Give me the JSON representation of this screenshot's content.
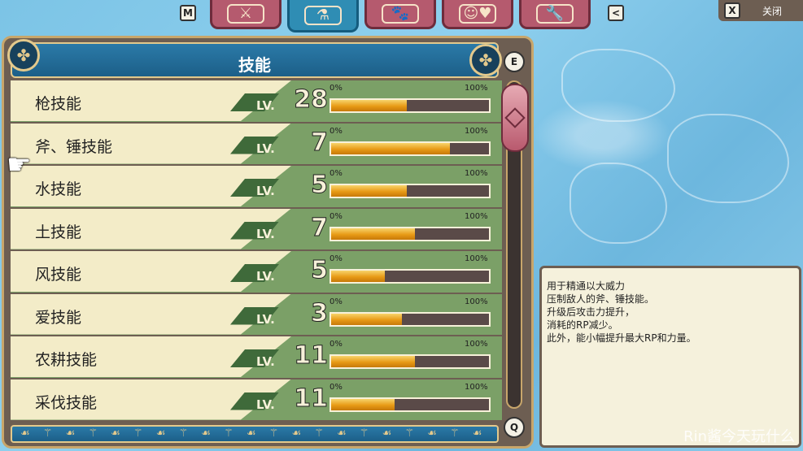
{
  "top_nav": {
    "left_key": "M",
    "right_key": "<",
    "tabs": [
      {
        "icon": "sword-shield-icon",
        "glyph": "⚔"
      },
      {
        "icon": "flask-hammer-icon",
        "glyph": "⚗"
      },
      {
        "icon": "monsters-icon",
        "glyph": "🐾"
      },
      {
        "icon": "face-heart-icon",
        "glyph": "☺♥"
      },
      {
        "icon": "wrench-icon",
        "glyph": "🔧"
      }
    ],
    "close_key": "X",
    "close_label": "关闭"
  },
  "panel": {
    "title": "技能",
    "rows": [
      {
        "name": "枪技能",
        "lv_label": "LV.",
        "level": "28",
        "pmin": "0%",
        "pmax": "100%",
        "progress": 0.48
      },
      {
        "name": "斧、锤技能",
        "lv_label": "LV.",
        "level": "7",
        "pmin": "0%",
        "pmax": "100%",
        "progress": 0.75
      },
      {
        "name": "水技能",
        "lv_label": "LV.",
        "level": "5",
        "pmin": "0%",
        "pmax": "100%",
        "progress": 0.48
      },
      {
        "name": "土技能",
        "lv_label": "LV.",
        "level": "7",
        "pmin": "0%",
        "pmax": "100%",
        "progress": 0.53
      },
      {
        "name": "风技能",
        "lv_label": "LV.",
        "level": "5",
        "pmin": "0%",
        "pmax": "100%",
        "progress": 0.34
      },
      {
        "name": "爱技能",
        "lv_label": "LV.",
        "level": "3",
        "pmin": "0%",
        "pmax": "100%",
        "progress": 0.45
      },
      {
        "name": "农耕技能",
        "lv_label": "LV.",
        "level": "11",
        "pmin": "0%",
        "pmax": "100%",
        "progress": 0.53
      },
      {
        "name": "采伐技能",
        "lv_label": "LV.",
        "level": "11",
        "pmin": "0%",
        "pmax": "100%",
        "progress": 0.4
      }
    ]
  },
  "scroll": {
    "up_key": "E",
    "down_key": "Q"
  },
  "description": {
    "lines": [
      "用于精通以大威力",
      "压制敌人的斧、锤技能。",
      "升级后攻击力提升，",
      "消耗的RP减少。",
      "此外，能小幅提升最大RP和力量。"
    ]
  },
  "watermark": "Rin酱今天玩什么",
  "colors": {
    "accent_blue": "#2b7aa8",
    "tab_pink": "#b55a6e",
    "bar_gold": "#e79a16"
  }
}
